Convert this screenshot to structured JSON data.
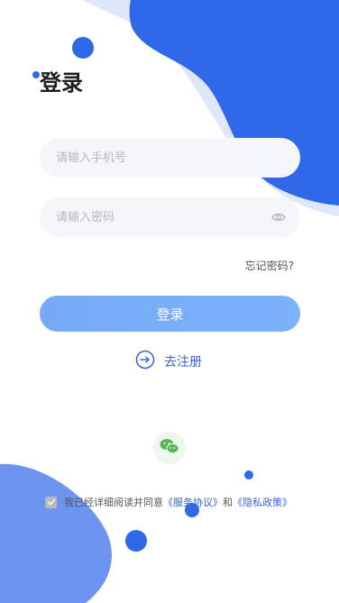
{
  "header": {
    "title": "登录"
  },
  "form": {
    "phone_placeholder": "请输入手机号",
    "password_placeholder": "请输入密码",
    "forgot_label": "忘记密码?",
    "login_label": "登录",
    "register_label": "去注册"
  },
  "agreement": {
    "checked": true,
    "prefix": "我已经详细阅读并同意",
    "service_link": "《服务协议》",
    "and": "和",
    "privacy_link": "《隐私政策》"
  },
  "icons": {
    "eye": "eye-icon",
    "register": "arrow-circle-icon",
    "wechat": "wechat-icon",
    "check": "check-icon"
  },
  "colors": {
    "accent": "#3366e6",
    "login_button": "#78aef8",
    "link": "#3a63d6"
  }
}
